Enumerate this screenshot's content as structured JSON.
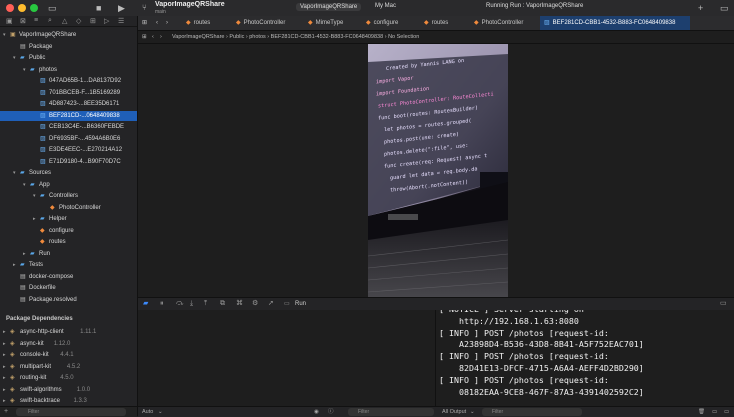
{
  "window": {
    "project_title": "VaporImageQRShare",
    "branch": "main",
    "scheme": "VaporImageQRShare",
    "destination": "My Mac",
    "run_status": "Running Run : VaporImageQRShare"
  },
  "tabs": [
    {
      "label": "routes",
      "icon": "swift-file-icon"
    },
    {
      "label": "PhotoController",
      "icon": "swift-file-icon"
    },
    {
      "label": "MimeType",
      "icon": "swift-file-icon"
    },
    {
      "label": "configure",
      "icon": "swift-file-icon"
    },
    {
      "label": "routes",
      "icon": "swift-file-icon"
    },
    {
      "label": "PhotoController",
      "icon": "swift-file-icon"
    },
    {
      "label": "BEF281CD-CBB1-4532-B883-FC0648409838",
      "icon": "image-file-icon",
      "active": true
    }
  ],
  "jumpbar": {
    "items": [
      "VaporImageQRShare",
      "Public",
      "photos",
      "BEF281CD-CBB1-4532-B883-FC0648409838",
      "No Selection"
    ]
  },
  "sidebar": {
    "items": [
      {
        "label": "VaporImageQRShare",
        "kind": "project",
        "level": 0,
        "expanded": true
      },
      {
        "label": "Package",
        "kind": "file",
        "level": 1
      },
      {
        "label": "Public",
        "kind": "folder",
        "level": 1,
        "expanded": true
      },
      {
        "label": "photos",
        "kind": "folder",
        "level": 2,
        "expanded": true
      },
      {
        "label": "047AD65B-1...DA8137D92",
        "kind": "image",
        "level": 3
      },
      {
        "label": "701BBCEB-F...1B5169289",
        "kind": "image",
        "level": 3
      },
      {
        "label": "4D887423-...8EE35D6171",
        "kind": "image",
        "level": 3
      },
      {
        "label": "BEF281CD-...0648409838",
        "kind": "image",
        "level": 3,
        "selected": true
      },
      {
        "label": "CEB13C4E-...B6360FEBDE",
        "kind": "image",
        "level": 3
      },
      {
        "label": "DF6935BF-...4594A6B0E6",
        "kind": "image",
        "level": 3
      },
      {
        "label": "E3DE4EEC-...E270214A12",
        "kind": "image",
        "level": 3
      },
      {
        "label": "E71D9180-4...B90F70D7C",
        "kind": "image",
        "level": 3
      },
      {
        "label": "Sources",
        "kind": "folder",
        "level": 1,
        "expanded": true
      },
      {
        "label": "App",
        "kind": "folder",
        "level": 2,
        "expanded": true
      },
      {
        "label": "Controllers",
        "kind": "folder",
        "level": 3,
        "expanded": true
      },
      {
        "label": "PhotoController",
        "kind": "swift",
        "level": 4
      },
      {
        "label": "Helper",
        "kind": "folder",
        "level": 3,
        "expanded": false
      },
      {
        "label": "configure",
        "kind": "swift",
        "level": 3
      },
      {
        "label": "routes",
        "kind": "swift",
        "level": 3
      },
      {
        "label": "Run",
        "kind": "folder",
        "level": 2,
        "expanded": false
      },
      {
        "label": "Tests",
        "kind": "folder",
        "level": 1,
        "expanded": false
      },
      {
        "label": "docker-compose",
        "kind": "file",
        "level": 1
      },
      {
        "label": "Dockerfile",
        "kind": "file",
        "level": 1
      },
      {
        "label": "Package.resolved",
        "kind": "file",
        "level": 1
      }
    ],
    "dependencies_header": "Package Dependencies",
    "dependencies": [
      {
        "name": "async-http-client",
        "version": "1.11.1"
      },
      {
        "name": "async-kit",
        "version": "1.12.0"
      },
      {
        "name": "console-kit",
        "version": "4.4.1"
      },
      {
        "name": "multipart-kit",
        "version": "4.5.2"
      },
      {
        "name": "routing-kit",
        "version": "4.5.0"
      },
      {
        "name": "swift-algorithms",
        "version": "1.0.0"
      },
      {
        "name": "swift-backtrace",
        "version": "1.3.3"
      }
    ],
    "filter_placeholder": "Filter"
  },
  "photo": {
    "code_lines": [
      "Created by Yannis LANG on",
      "import Vapor",
      "import Foundation",
      "struct PhotoController: RouteCollecti",
      "func boot(routes: RoutesBuilder)",
      "let photos = routes.grouped(",
      "photos.post(use: create)",
      "photos.delete(\":file\", use:",
      "func create(req: Request) async t",
      "guard let data = req.body.da",
      "throw(Abort(.notContent))"
    ]
  },
  "debug": {
    "target": "Run"
  },
  "console": {
    "lines": [
      "[ NOTICE ] Server starting on",
      "    http://192.168.1.63:8080",
      "[ INFO ] POST /photos [request-id:",
      "    A23898D4-B536-43D8-8B41-A5F752EAC701]",
      "[ INFO ] POST /photos [request-id:",
      "    82D41E13-DFCF-4715-A6A4-AEFF4D2BD290]",
      "[ INFO ] POST /photos [request-id:",
      "    08182EAA-9CE8-467F-87A3-4391402592C2]"
    ]
  },
  "bottom": {
    "auto_label": "Auto",
    "filter_placeholder": "Filter",
    "output_label": "All Output",
    "filter2_placeholder": "Filter"
  },
  "colors": {
    "selection": "#1f5fb8",
    "active_tab": "#1d3f6e",
    "folder": "#5aa7e8",
    "swift": "#f08a3c"
  }
}
